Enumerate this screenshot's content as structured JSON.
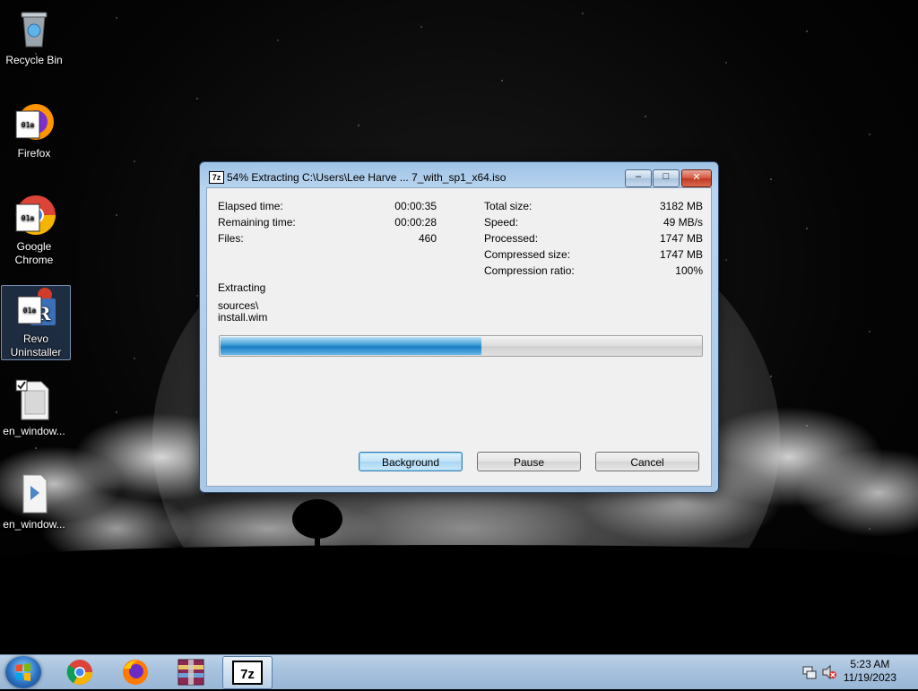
{
  "desktop": {
    "icons": [
      {
        "label": "Recycle Bin",
        "icon": "recycle-bin-icon"
      },
      {
        "label": "Firefox",
        "icon": "firefox-icon"
      },
      {
        "label": "Google Chrome",
        "icon": "chrome-icon"
      },
      {
        "label": "Revo Uninstaller",
        "icon": "revo-uninstaller-icon"
      },
      {
        "label": "en_window...",
        "icon": "iso-file-icon"
      },
      {
        "label": "en_window...",
        "icon": "file-icon"
      }
    ]
  },
  "dialog": {
    "title": "54% Extracting C:\\Users\\Lee Harve ... 7_with_sp1_x64.iso",
    "app_badge": "7z",
    "title_buttons": {
      "minimize": "–",
      "maximize": "□",
      "close": "✕"
    },
    "stats_left": [
      {
        "label": "Elapsed time:",
        "value": "00:00:35"
      },
      {
        "label": "Remaining time:",
        "value": "00:00:28"
      },
      {
        "label": "Files:",
        "value": "460"
      }
    ],
    "stats_right": [
      {
        "label": "Total size:",
        "value": "3182 MB"
      },
      {
        "label": "Speed:",
        "value": "49 MB/s"
      },
      {
        "label": "Processed:",
        "value": "1747 MB"
      },
      {
        "label": "Compressed size:",
        "value": "1747 MB"
      },
      {
        "label": "Compression ratio:",
        "value": "100%"
      }
    ],
    "status": "Extracting",
    "current_path": "sources\\",
    "current_file": "install.wim",
    "progress_fraction": 0.54,
    "buttons": {
      "background": "Background",
      "pause": "Pause",
      "cancel": "Cancel"
    }
  },
  "taskbar": {
    "pinned": [
      {
        "name": "chrome",
        "icon": "chrome-icon"
      },
      {
        "name": "firefox",
        "icon": "firefox-icon"
      },
      {
        "name": "winrar",
        "icon": "archive-icon"
      },
      {
        "name": "7-zip",
        "icon": "7zip-icon",
        "label": "7z",
        "active": true
      }
    ],
    "clock_time": "5:23 AM",
    "clock_date": "11/19/2023"
  },
  "colors": {
    "progress": "#1a7fc4",
    "titlebar": "#b9d4ef",
    "close": "#c03a22"
  }
}
